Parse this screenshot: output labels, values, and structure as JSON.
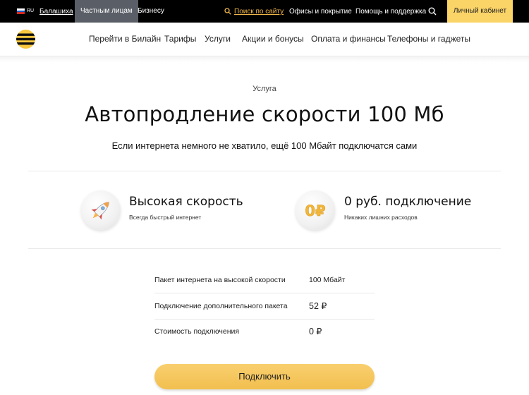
{
  "topbar": {
    "lang": "RU",
    "region": "Балашиха",
    "segments": [
      "Частным лицам",
      "Бизнесу"
    ],
    "search_label": "Поиск по сайту",
    "links": [
      "Офисы и покрытие",
      "Помощь и поддержка"
    ],
    "cabinet_label": "Личный кабинет"
  },
  "nav": {
    "items": [
      "Перейти в Билайн",
      "Тарифы",
      "Услуги",
      "Акции и бонусы",
      "Оплата и финансы",
      "Телефоны и гаджеты"
    ]
  },
  "hero": {
    "eyebrow": "Услуга",
    "title": "Автопродление скорости 100 Мб",
    "subtitle": "Если интернета немного не хватило, ещё 100 Мбайт подключатся сами"
  },
  "features": [
    {
      "icon": "rocket-icon",
      "title": "Высокая скорость",
      "subtitle": "Всегда быстрый интернет"
    },
    {
      "icon": "zero-ruble-icon",
      "title": "0 руб. подключение",
      "subtitle": "Никаких лишних расходов",
      "icon_text": "0₽"
    }
  ],
  "table": {
    "rows": [
      {
        "label": "Пакет интернета на высокой скорости",
        "value": "100 Мбайт"
      },
      {
        "label": "Подключение дополнительного пакета",
        "value": "52 ₽"
      },
      {
        "label": "Стоимость подключения",
        "value": "0 ₽"
      }
    ]
  },
  "cta": {
    "label": "Подключить"
  },
  "colors": {
    "accent": "#fbd468",
    "button": "#f4c35a",
    "search": "#f0b74a"
  }
}
